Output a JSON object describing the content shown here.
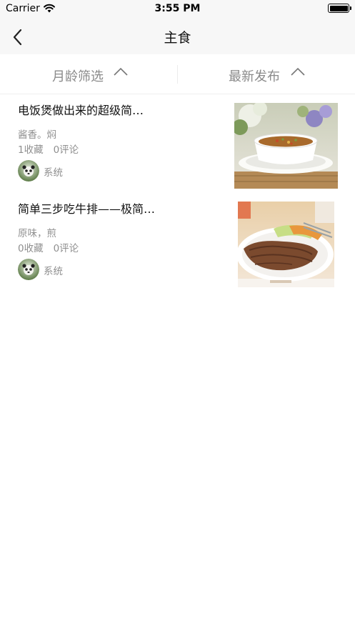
{
  "status_bar": {
    "carrier": "Carrier",
    "time": "3:55 PM"
  },
  "nav": {
    "title": "主食",
    "back_icon": "chevron-left-icon"
  },
  "filters": [
    {
      "label": "月龄筛选",
      "icon": "chevron-up-icon"
    },
    {
      "label": "最新发布",
      "icon": "chevron-up-icon"
    }
  ],
  "recipes": [
    {
      "title": "电饭煲做出来的超级简…",
      "tags": "酱香。焖",
      "favorites": "1收藏",
      "comments": "0评论",
      "author": "系统"
    },
    {
      "title": "简单三步吃牛排——极简…",
      "tags": "原味，煎",
      "favorites": "0收藏",
      "comments": "0评论",
      "author": "系统"
    }
  ],
  "colors": {
    "bar_background": "#f7f7f7",
    "secondary_text": "#8f8f8f",
    "filter_text": "#8a8a8a"
  }
}
